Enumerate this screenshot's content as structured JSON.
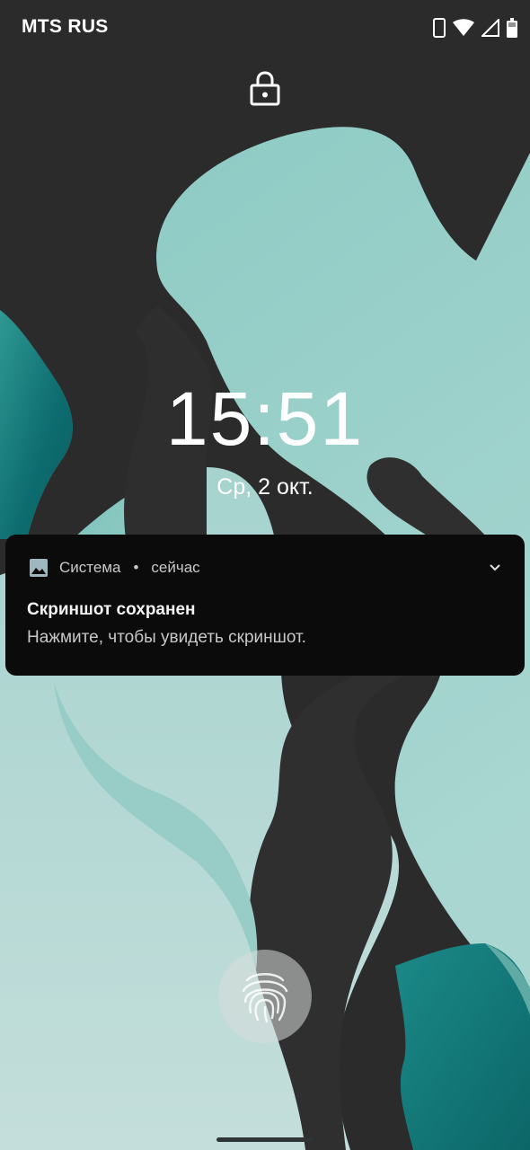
{
  "status_bar": {
    "carrier": "MTS RUS",
    "icons": [
      "phone-icon",
      "wifi-icon",
      "signal-icon",
      "battery-icon"
    ]
  },
  "lock_screen": {
    "lock_icon": "lock-icon",
    "time": "15:51",
    "date": "Ср, 2 окт."
  },
  "notification": {
    "app_icon": "image-icon",
    "app_name": "Система",
    "separator": "•",
    "timestamp": "сейчас",
    "title": "Скриншот сохранен",
    "text": "Нажмите, чтобы увидеть скриншот.",
    "expand_icon": "chevron-down-icon"
  },
  "fingerprint": {
    "icon": "fingerprint-icon"
  },
  "colors": {
    "background_dark": "#2b2b2b",
    "teal_light": "#8fc9c3",
    "teal_dark": "#0f7173",
    "notification_bg": "#0b0b0b"
  }
}
